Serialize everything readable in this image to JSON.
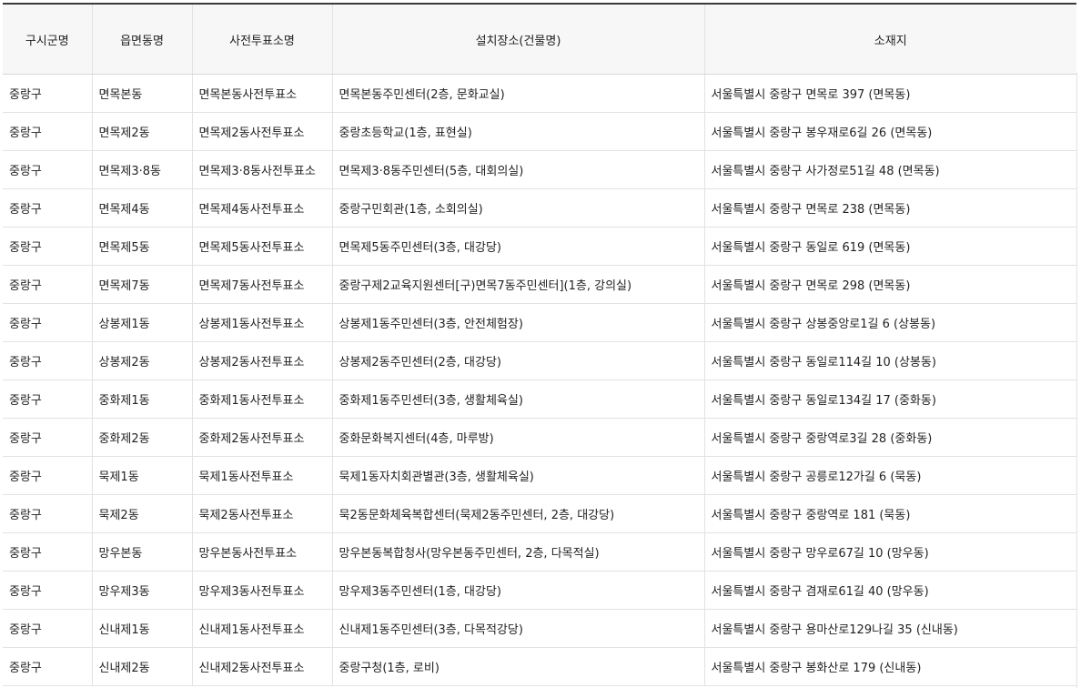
{
  "table": {
    "headers": [
      "구시군명",
      "읍면동명",
      "사전투표소명",
      "설치장소(건물명)",
      "소재지"
    ],
    "rows": [
      [
        "중랑구",
        "면목본동",
        "면목본동사전투표소",
        "면목본동주민센터(2층, 문화교실)",
        "서울특별시 중랑구 면목로 397 (면목동)"
      ],
      [
        "중랑구",
        "면목제2동",
        "면목제2동사전투표소",
        "중랑초등학교(1층, 표현실)",
        "서울특별시 중랑구 봉우재로6길 26 (면목동)"
      ],
      [
        "중랑구",
        "면목제3·8동",
        "면목제3·8동사전투표소",
        "면목제3·8동주민센터(5층, 대회의실)",
        "서울특별시 중랑구 사가정로51길 48 (면목동)"
      ],
      [
        "중랑구",
        "면목제4동",
        "면목제4동사전투표소",
        "중랑구민회관(1층, 소회의실)",
        "서울특별시 중랑구 면목로 238 (면목동)"
      ],
      [
        "중랑구",
        "면목제5동",
        "면목제5동사전투표소",
        "면목제5동주민센터(3층, 대강당)",
        "서울특별시 중랑구 동일로 619 (면목동)"
      ],
      [
        "중랑구",
        "면목제7동",
        "면목제7동사전투표소",
        "중랑구제2교육지원센터[구)면목7동주민센터](1층, 강의실)",
        "서울특별시 중랑구 면목로 298 (면목동)"
      ],
      [
        "중랑구",
        "상봉제1동",
        "상봉제1동사전투표소",
        "상봉제1동주민센터(3층, 안전체험장)",
        "서울특별시 중랑구 상봉중앙로1길 6 (상봉동)"
      ],
      [
        "중랑구",
        "상봉제2동",
        "상봉제2동사전투표소",
        "상봉제2동주민센터(2층, 대강당)",
        "서울특별시 중랑구 동일로114길 10 (상봉동)"
      ],
      [
        "중랑구",
        "중화제1동",
        "중화제1동사전투표소",
        "중화제1동주민센터(3층, 생활체육실)",
        "서울특별시 중랑구 동일로134길 17 (중화동)"
      ],
      [
        "중랑구",
        "중화제2동",
        "중화제2동사전투표소",
        "중화문화복지센터(4층, 마루방)",
        "서울특별시 중랑구 중랑역로3길 28 (중화동)"
      ],
      [
        "중랑구",
        "묵제1동",
        "묵제1동사전투표소",
        "묵제1동자치회관별관(3층, 생활체육실)",
        "서울특별시 중랑구 공릉로12가길 6 (묵동)"
      ],
      [
        "중랑구",
        "묵제2동",
        "묵제2동사전투표소",
        "묵2동문화체육복합센터(묵제2동주민센터, 2층, 대강당)",
        "서울특별시 중랑구 중랑역로 181 (묵동)"
      ],
      [
        "중랑구",
        "망우본동",
        "망우본동사전투표소",
        "망우본동복합청사(망우본동주민센터, 2층, 다목적실)",
        "서울특별시 중랑구 망우로67길 10 (망우동)"
      ],
      [
        "중랑구",
        "망우제3동",
        "망우제3동사전투표소",
        "망우제3동주민센터(1층, 대강당)",
        "서울특별시 중랑구 겸재로61길 40 (망우동)"
      ],
      [
        "중랑구",
        "신내제1동",
        "신내제1동사전투표소",
        "신내제1동주민센터(3층, 다목적강당)",
        "서울특별시 중랑구 용마산로129나길 35 (신내동)"
      ],
      [
        "중랑구",
        "신내제2동",
        "신내제2동사전투표소",
        "중랑구청(1층, 로비)",
        "서울특별시 중랑구 봉화산로 179 (신내동)"
      ]
    ]
  }
}
